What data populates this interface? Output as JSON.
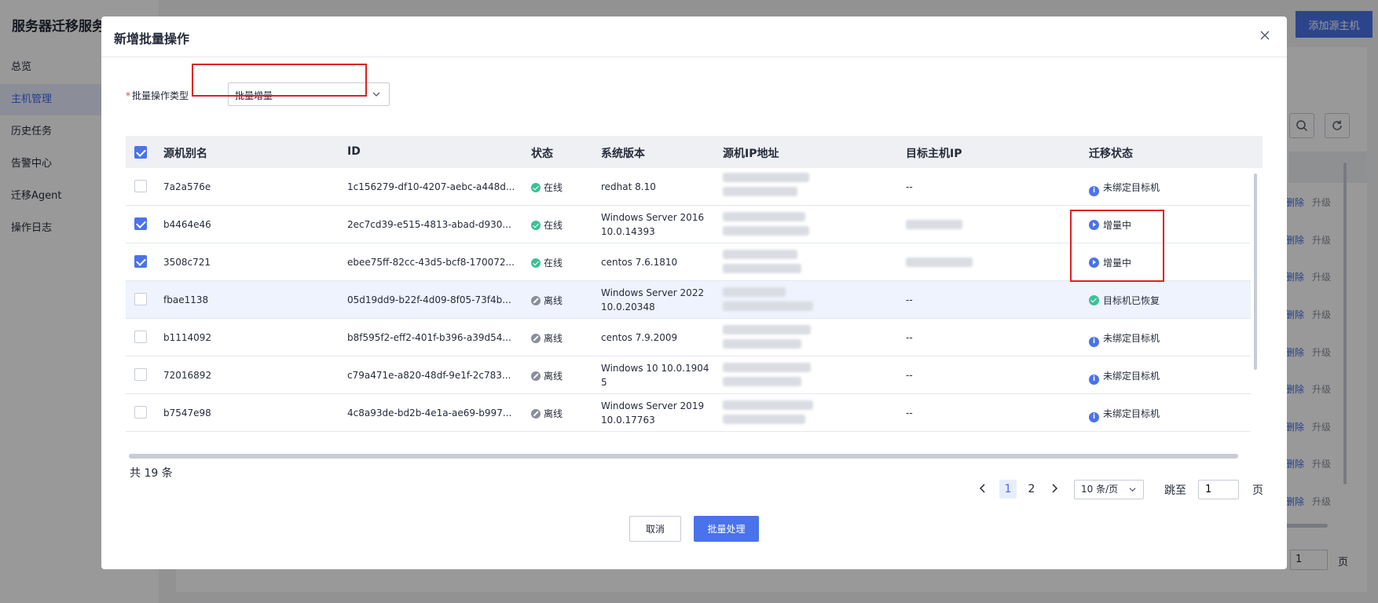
{
  "app": {
    "title": "服务器迁移服务",
    "nav": [
      {
        "label": "总览"
      },
      {
        "label": "主机管理",
        "active": true
      },
      {
        "label": "历史任务"
      },
      {
        "label": "告警中心"
      },
      {
        "label": "迁移Agent"
      },
      {
        "label": "操作日志"
      }
    ],
    "add_host_label": "添加源主机",
    "row_actions": {
      "delete": "删除",
      "upgrade": "升级"
    },
    "jump_value": "1",
    "page_unit": "页"
  },
  "modal": {
    "title": "新增批量操作",
    "form": {
      "required_mark": "*",
      "op_type_label": "批量操作类型",
      "op_type_value": "批量增量"
    },
    "table": {
      "headers": [
        "源机别名",
        "ID",
        "状态",
        "系统版本",
        "源机IP地址",
        "目标主机IP",
        "迁移状态"
      ],
      "rows": [
        {
          "checked": false,
          "alias": "7a2a576e",
          "id": "1c156279-df10-4207-aebc-a448d...",
          "status": "在线",
          "status_type": "online",
          "os": [
            "redhat 8.10"
          ],
          "target_ip": "--",
          "migration": "未绑定目标机",
          "migration_type": "info"
        },
        {
          "checked": true,
          "alias": "b4464e46",
          "id": "2ec7cd39-e515-4813-abad-d930...",
          "status": "在线",
          "status_type": "online",
          "os": [
            "Windows Server 2016",
            "10.0.14393"
          ],
          "target_ip": "",
          "migration": "增量中",
          "migration_type": "prog"
        },
        {
          "checked": true,
          "alias": "3508c721",
          "id": "ebee75ff-82cc-43d5-bcf8-170072...",
          "status": "在线",
          "status_type": "online",
          "os": [
            "centos 7.6.1810"
          ],
          "target_ip": "",
          "migration": "增量中",
          "migration_type": "prog"
        },
        {
          "checked": false,
          "alias": "fbae1138",
          "id": "05d19dd9-b22f-4d09-8f05-73f4b...",
          "status": "离线",
          "status_type": "offline",
          "os": [
            "Windows Server 2022",
            "10.0.20348"
          ],
          "target_ip": "--",
          "migration": "目标机已恢复",
          "migration_type": "done"
        },
        {
          "checked": false,
          "alias": "b1114092",
          "id": "b8f595f2-eff2-401f-b396-a39d54...",
          "status": "离线",
          "status_type": "offline",
          "os": [
            "centos 7.9.2009"
          ],
          "target_ip": "--",
          "migration": "未绑定目标机",
          "migration_type": "info"
        },
        {
          "checked": false,
          "alias": "72016892",
          "id": "c79a471e-a820-48df-9e1f-2c783...",
          "status": "离线",
          "status_type": "offline",
          "os": [
            "Windows 10 10.0.1904",
            "5"
          ],
          "target_ip": "--",
          "migration": "未绑定目标机",
          "migration_type": "info"
        },
        {
          "checked": false,
          "alias": "b7547e98",
          "id": "4c8a93de-bd2b-4e1a-ae69-b997...",
          "status": "离线",
          "status_type": "offline",
          "os": [
            "Windows Server 2019",
            "10.0.17763"
          ],
          "target_ip": "--",
          "migration": "未绑定目标机",
          "migration_type": "info"
        }
      ]
    },
    "pagination": {
      "total": "共 19 条",
      "pages": [
        "1",
        "2"
      ],
      "current_page": "1",
      "page_size": "10 条/页",
      "jump_label": "跳至",
      "jump_value": "1",
      "jump_unit": "页"
    },
    "buttons": {
      "cancel": "取消",
      "confirm": "批量处理"
    }
  },
  "colors": {
    "primary": "#4a72ea",
    "online": "#3ac295",
    "offline": "#8a8e99",
    "annotation": "#e02020"
  }
}
